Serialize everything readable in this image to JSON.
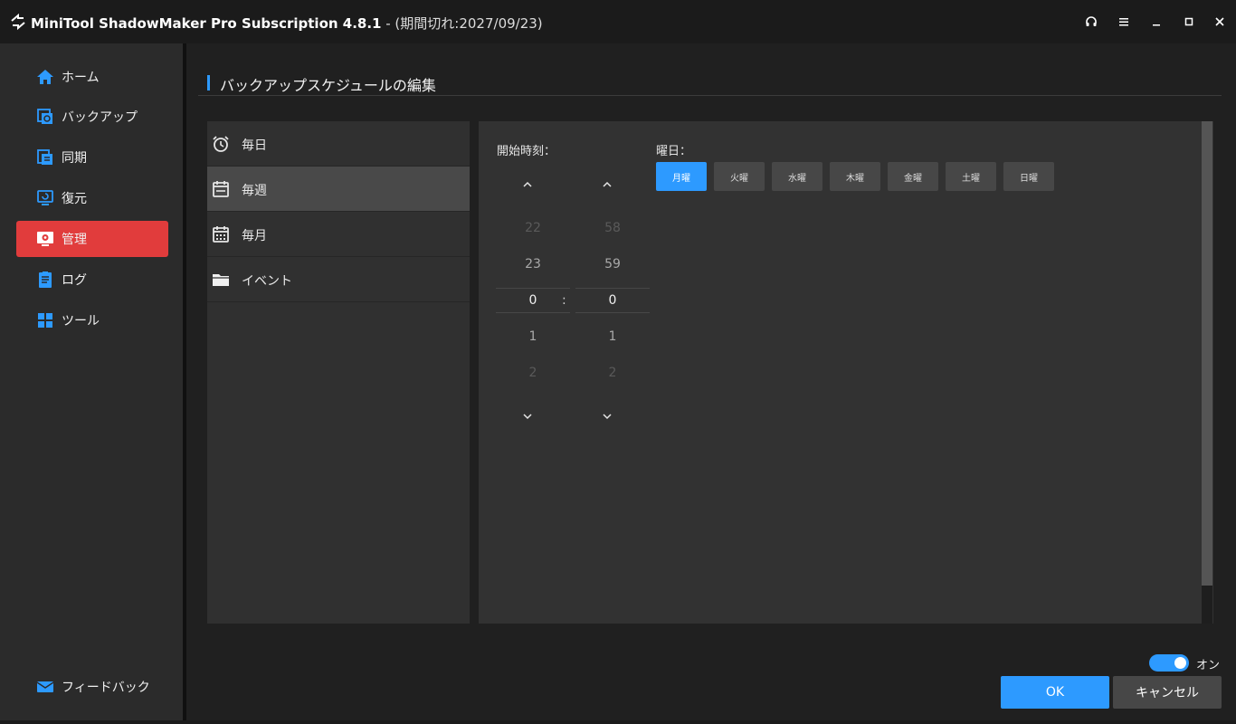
{
  "window": {
    "title": "MiniTool ShadowMaker Pro Subscription 4.8.1",
    "subtitle": " - (期間切れ:2027/09/23)",
    "icons": [
      "headphones-icon",
      "menu-icon",
      "minimize-icon",
      "maximize-icon",
      "close-icon"
    ]
  },
  "sidebar": {
    "items": [
      {
        "label": "ホーム",
        "icon": "home-icon"
      },
      {
        "label": "バックアップ",
        "icon": "backup-icon"
      },
      {
        "label": "同期",
        "icon": "sync-icon"
      },
      {
        "label": "復元",
        "icon": "restore-icon"
      },
      {
        "label": "管理",
        "icon": "manage-icon",
        "active": true
      },
      {
        "label": "ログ",
        "icon": "log-icon"
      },
      {
        "label": "ツール",
        "icon": "tools-icon"
      }
    ],
    "feedback": {
      "label": "フィードバック",
      "icon": "mail-icon"
    }
  },
  "page": {
    "title": "バックアップスケジュールの編集"
  },
  "frequency": {
    "items": [
      {
        "label": "毎日",
        "icon": "alarm-clock-icon"
      },
      {
        "label": "毎週",
        "icon": "calendar-week-icon",
        "active": true
      },
      {
        "label": "毎月",
        "icon": "calendar-month-icon"
      },
      {
        "label": "イベント",
        "icon": "folder-icon"
      }
    ]
  },
  "schedule": {
    "start_time_label": "開始時刻：",
    "hours": {
      "far_above": "22",
      "above": "23",
      "selected": "0",
      "below": "1",
      "far_below": "2"
    },
    "minutes": {
      "far_above": "58",
      "above": "59",
      "selected": "0",
      "below": "1",
      "far_below": "2"
    },
    "separator": ":",
    "weekday_label": "曜日：",
    "weekdays": [
      {
        "label": "月曜",
        "selected": true
      },
      {
        "label": "火曜",
        "selected": false
      },
      {
        "label": "水曜",
        "selected": false
      },
      {
        "label": "木曜",
        "selected": false
      },
      {
        "label": "金曜",
        "selected": false
      },
      {
        "label": "土曜",
        "selected": false
      },
      {
        "label": "日曜",
        "selected": false
      }
    ]
  },
  "footer": {
    "toggle_label": "オン",
    "toggle_on": true,
    "ok_label": "OK",
    "cancel_label": "キャンセル"
  },
  "colors": {
    "accent": "#2d9aff",
    "active_nav": "#e13c3c"
  }
}
